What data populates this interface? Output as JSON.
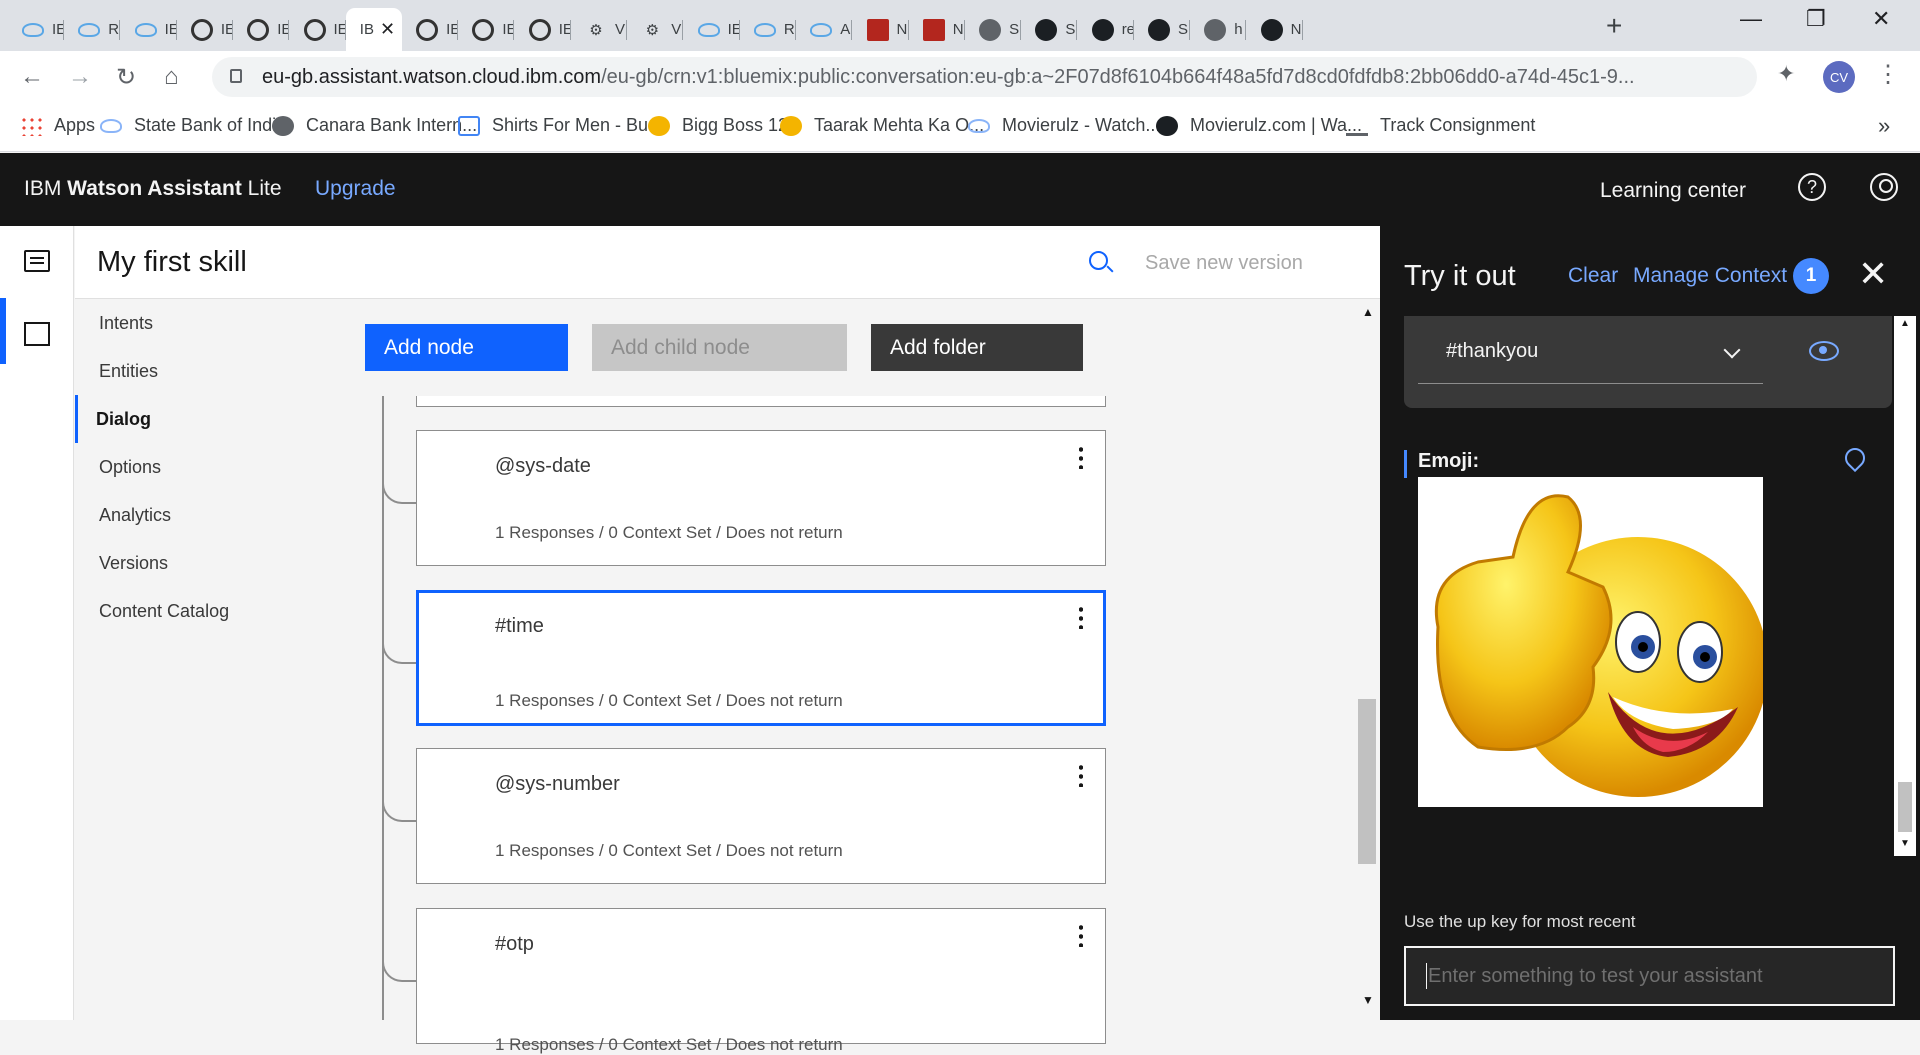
{
  "browser": {
    "tabs": [
      {
        "label": "IE",
        "icon": "cloud-icon"
      },
      {
        "label": "R",
        "icon": "cloud-icon"
      },
      {
        "label": "IE",
        "icon": "cloud-icon"
      },
      {
        "label": "IE",
        "icon": "ibm-watson-icon"
      },
      {
        "label": "IE",
        "icon": "ibm-watson-icon"
      },
      {
        "label": "IE",
        "icon": "ibm-watson-icon"
      },
      {
        "label": "IB",
        "icon": "none",
        "active": true
      },
      {
        "label": "IE",
        "icon": "ibm-watson-icon"
      },
      {
        "label": "IE",
        "icon": "ibm-watson-icon"
      },
      {
        "label": "IE",
        "icon": "ibm-watson-icon"
      },
      {
        "label": "V",
        "icon": "truck-icon"
      },
      {
        "label": "V",
        "icon": "truck-icon"
      },
      {
        "label": "IE",
        "icon": "cloud-icon"
      },
      {
        "label": "R",
        "icon": "cloud-icon"
      },
      {
        "label": "A",
        "icon": "cloud-icon"
      },
      {
        "label": "N",
        "icon": "red-app-icon"
      },
      {
        "label": "N",
        "icon": "red-app-icon"
      },
      {
        "label": "S",
        "icon": "globe-icon"
      },
      {
        "label": "S",
        "icon": "github-icon"
      },
      {
        "label": "re",
        "icon": "github-icon"
      },
      {
        "label": "S",
        "icon": "github-icon"
      },
      {
        "label": "h",
        "icon": "globe-icon"
      },
      {
        "label": "N",
        "icon": "github-icon"
      }
    ],
    "url_host": "eu-gb.assistant.watson.cloud.ibm.com",
    "url_path": "/eu-gb/crn:v1:bluemix:public:conversation:eu-gb:a~2F07d8f6104b664f48a5fd7d8cd0fdfdb8:2bb06dd0-a74d-45c1-9...",
    "profile_initials": "CV",
    "bookmarks": [
      {
        "label": "Apps",
        "icon": "apps-icon"
      },
      {
        "label": "State Bank of India",
        "icon": "cloud-icon"
      },
      {
        "label": "Canara Bank Intern...",
        "icon": "globe-icon"
      },
      {
        "label": "Shirts For Men - Bu...",
        "icon": "shirt-icon"
      },
      {
        "label": "Bigg Boss 12",
        "icon": "check-icon"
      },
      {
        "label": "Taarak Mehta Ka O...",
        "icon": "check-icon"
      },
      {
        "label": "Movierulz - Watch...",
        "icon": "cloud-icon"
      },
      {
        "label": "Movierulz.com | Wa...",
        "icon": "github-icon"
      },
      {
        "label": "Track Consignment",
        "icon": "truck-icon"
      }
    ]
  },
  "header": {
    "brand_prefix": "IBM ",
    "brand_bold": "Watson Assistant",
    "brand_suffix": " Lite",
    "upgrade": "Upgrade",
    "learning_center": "Learning center",
    "help_glyph": "?"
  },
  "skill": {
    "title": "My first skill",
    "save_version": "Save new version"
  },
  "sidenav": {
    "items": [
      "Intents",
      "Entities",
      "Dialog",
      "Options",
      "Analytics",
      "Versions",
      "Content Catalog"
    ],
    "active": "Dialog"
  },
  "dialog": {
    "add_node": "Add node",
    "add_child_node": "Add child node",
    "add_folder": "Add folder",
    "nodes": [
      {
        "title": "@sys-date",
        "meta": "1 Responses / 0 Context Set / Does not return"
      },
      {
        "title": "#time",
        "meta": "1 Responses / 0 Context Set / Does not return",
        "selected": true
      },
      {
        "title": "@sys-number",
        "meta": "1 Responses / 0 Context Set / Does not return"
      },
      {
        "title": "#otp",
        "meta": "1 Responses / 0 Context Set / Does not return"
      }
    ]
  },
  "tryit": {
    "title": "Try it out",
    "clear": "Clear",
    "manage_context": "Manage Context",
    "context_count": "1",
    "intent": "#thankyou",
    "emoji_label": "Emoji:",
    "hint": "Use the up key for most recent",
    "input_placeholder": "Enter something to test your assistant"
  },
  "colors": {
    "ibm_blue": "#0f62fe",
    "link_blue": "#78a9ff",
    "header_bg": "#161616"
  }
}
